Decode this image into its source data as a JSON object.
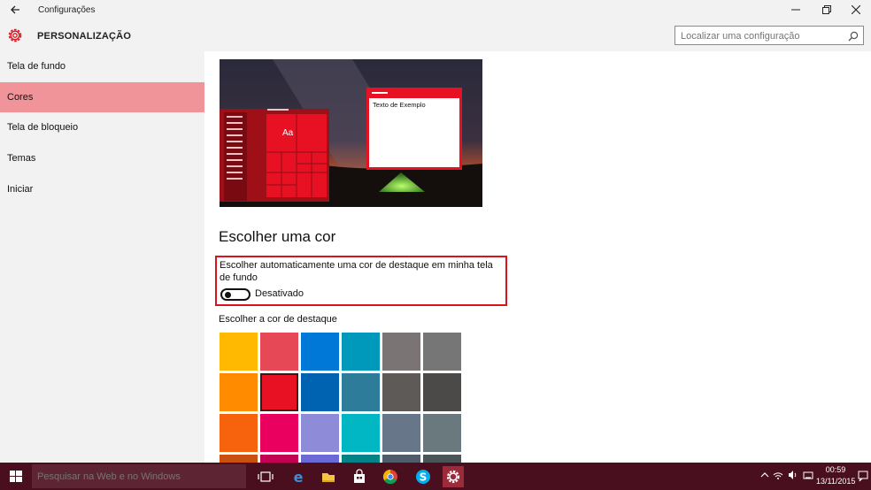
{
  "window": {
    "title": "Configurações",
    "back_icon": "back-arrow-icon",
    "controls": [
      "minimize-icon",
      "restore-icon",
      "close-icon"
    ]
  },
  "header": {
    "title": "PERSONALIZAÇÃO",
    "icon": "gear-icon",
    "search": {
      "placeholder": "Localizar uma configuração",
      "icon": "search-icon"
    }
  },
  "sidebar": {
    "items": [
      {
        "label": "Tela de fundo",
        "active": false
      },
      {
        "label": "Cores",
        "active": true
      },
      {
        "label": "Tela de bloqueio",
        "active": false
      },
      {
        "label": "Temas",
        "active": false
      },
      {
        "label": "Iniciar",
        "active": false
      }
    ]
  },
  "main": {
    "preview": {
      "sample_window_text": "Texto de Exemplo",
      "tile_text": "Aa"
    },
    "heading": "Escolher uma cor",
    "auto_accent": {
      "label": "Escolher automaticamente uma cor de destaque em minha tela de fundo",
      "toggle_state": "Desativado",
      "enabled": false
    },
    "accent_label": "Escolher a cor de destaque",
    "swatch_columns": 6,
    "swatches": [
      "#FFB900",
      "#E74856",
      "#0078D7",
      "#0099BC",
      "#7A7574",
      "#767676",
      "#FF8C00",
      "#E81123",
      "#0063B1",
      "#2D7D9A",
      "#5D5A58",
      "#4C4A48",
      "#F7630C",
      "#EA005E",
      "#8E8CD8",
      "#00B7C3",
      "#68768A",
      "#69797E",
      "#CA5010",
      "#C30052",
      "#6B69D6",
      "#038387",
      "#515C6B",
      "#4A5459"
    ],
    "selected_swatch": 7
  },
  "taskbar": {
    "search_placeholder": "Pesquisar na Web e no Windows",
    "clock_time": "00:59",
    "clock_date": "13/11/2015",
    "icons": [
      "windows-start-icon",
      "task-view-icon",
      "edge-icon",
      "file-explorer-icon",
      "store-icon",
      "chrome-icon",
      "skype-icon",
      "settings-icon"
    ]
  },
  "colors": {
    "accent": "#E81123",
    "sidebar_active": "#F0949A",
    "taskbar": "#4A0F1E",
    "chrome": "#F2F2F2"
  }
}
